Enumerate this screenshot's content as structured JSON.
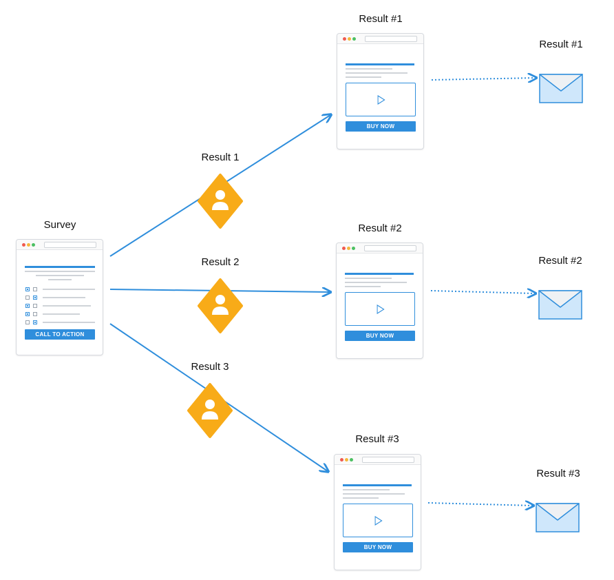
{
  "survey": {
    "title": "Survey",
    "cta_label": "CALL TO ACTION"
  },
  "branches": [
    {
      "edge_label": "Result 1",
      "page_title": "Result #1",
      "button_label": "BUY NOW",
      "email_label": "Result #1"
    },
    {
      "edge_label": "Result 2",
      "page_title": "Result #2",
      "button_label": "BUY NOW",
      "email_label": "Result #2"
    },
    {
      "edge_label": "Result 3",
      "page_title": "Result #3",
      "button_label": "BUY NOW",
      "email_label": "Result #3"
    }
  ],
  "icons": {
    "person": "person-icon",
    "play": "play-icon",
    "envelope": "envelope-icon"
  },
  "colors": {
    "accent": "#2f8edc",
    "diamond": "#f8ab18",
    "envelope_fill": "#cfe7fb",
    "border": "#d6d9de"
  }
}
